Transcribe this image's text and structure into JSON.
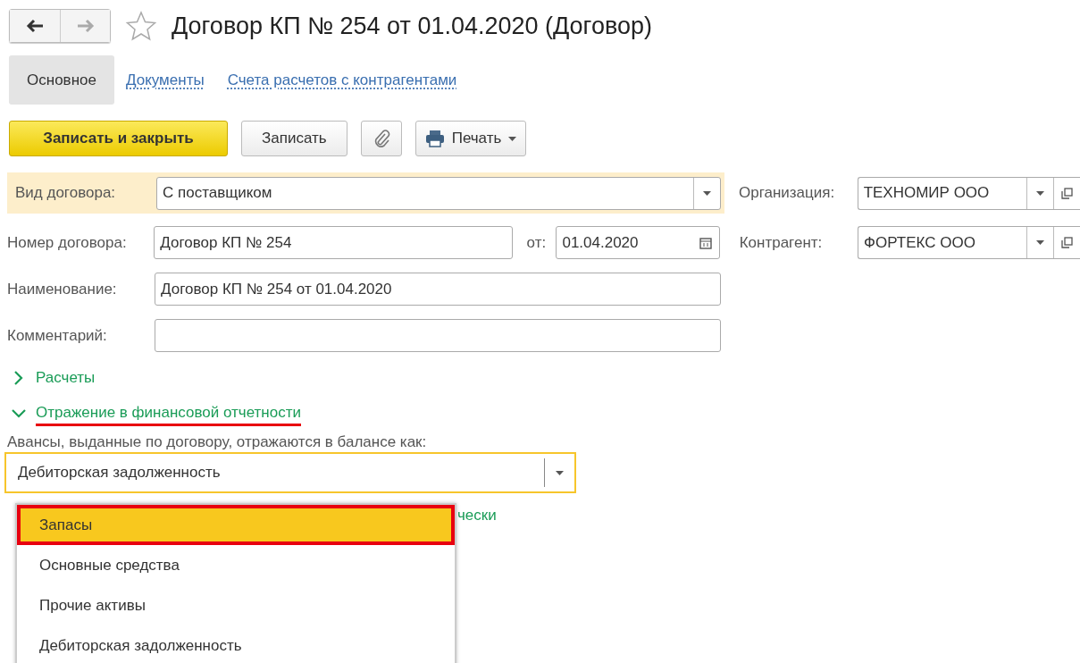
{
  "window": {
    "title": "Договор КП № 254 от 01.04.2020 (Договор)",
    "favorite": false
  },
  "nav_buttons": [
    {
      "kind": "back",
      "disabled": false
    },
    {
      "kind": "forward",
      "disabled": true
    }
  ],
  "tabs": [
    {
      "label": "Основное",
      "selected": true
    },
    {
      "label": "Документы",
      "selected": false
    },
    {
      "label": "Счета расчетов с контрагентами",
      "selected": false
    }
  ],
  "toolbar": [
    {
      "kind": "primary",
      "label": "Записать и закрыть"
    },
    {
      "kind": "plain",
      "label": "Записать"
    },
    {
      "kind": "attach"
    },
    {
      "kind": "print",
      "label": "Печать"
    }
  ],
  "contract_type": {
    "label": "Вид договора:",
    "value": "С поставщиком",
    "highlighted": true
  },
  "organization": {
    "label": "Организация:",
    "value": "ТЕХНОМИР ООО"
  },
  "number": {
    "label": "Номер договора:",
    "value": "Договор КП № 254"
  },
  "date": {
    "label": "от:",
    "value": "01.04.2020"
  },
  "counterparty": {
    "label": "Контрагент:",
    "value": "ФОРТЕКС ООО"
  },
  "name": {
    "label": "Наименование:",
    "value": "Договор КП № 254 от 01.04.2020"
  },
  "comment": {
    "label": "Комментарий:"
  },
  "sections": [
    {
      "label": "Расчеты",
      "expanded": false,
      "underlined": false
    },
    {
      "label": "Отражение в финансовой отчетности",
      "expanded": true,
      "underlined": true
    }
  ],
  "advances": {
    "label": "Авансы, выданные по договору, отражаются в балансе как:",
    "value": "Дебиторская задолженность",
    "highlighted": true
  },
  "covered_link_tail": "чески",
  "dropdown": {
    "items": [
      {
        "label": "Запасы",
        "selected": true
      },
      {
        "label": "Основные средства",
        "selected": false
      },
      {
        "label": "Прочие активы",
        "selected": false
      },
      {
        "label": "Дебиторская задолженность",
        "selected": false
      }
    ]
  }
}
